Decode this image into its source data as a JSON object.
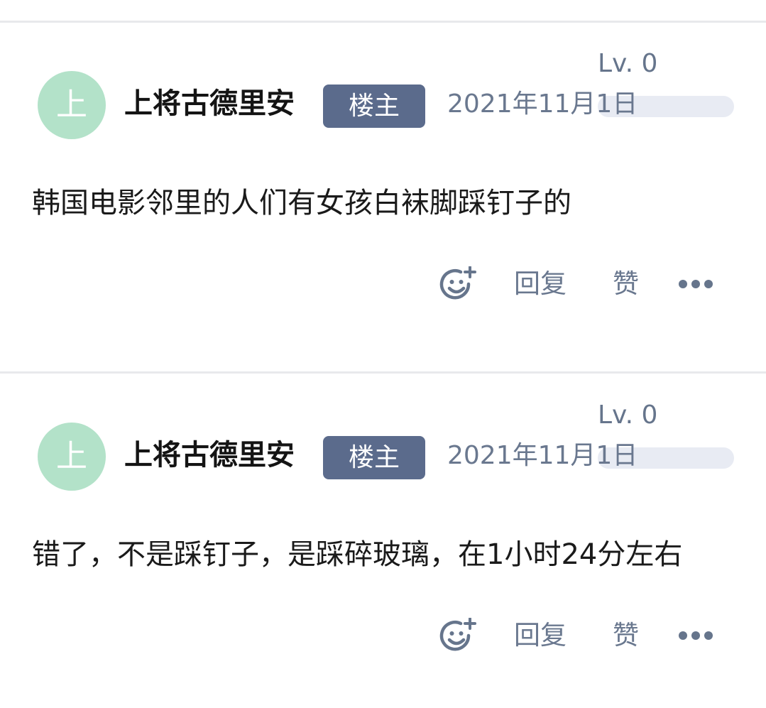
{
  "posts": [
    {
      "avatar_char": "上",
      "username": "上将古德里安",
      "badge": "楼主",
      "level": "Lv. 0",
      "date": "2021年11月1日",
      "content": "韩国电影邻里的人们有女孩白袜脚踩钉子的",
      "actions": {
        "reply": "回复",
        "like": "赞"
      }
    },
    {
      "avatar_char": "上",
      "username": "上将古德里安",
      "badge": "楼主",
      "level": "Lv. 0",
      "date": "2021年11月1日",
      "content": "错了，不是踩钉子，是踩碎玻璃，在1小时24分左右",
      "actions": {
        "reply": "回复",
        "like": "赞"
      }
    }
  ],
  "icons": {
    "emoji": "smiley-plus-icon",
    "more": "more-dots-icon"
  },
  "colors": {
    "avatar_bg": "#b3e2c9",
    "badge_bg": "#5b6b8c",
    "meta_text": "#6a788f",
    "level_bar": "#e8ebf3",
    "divider": "#e8e9ec"
  }
}
